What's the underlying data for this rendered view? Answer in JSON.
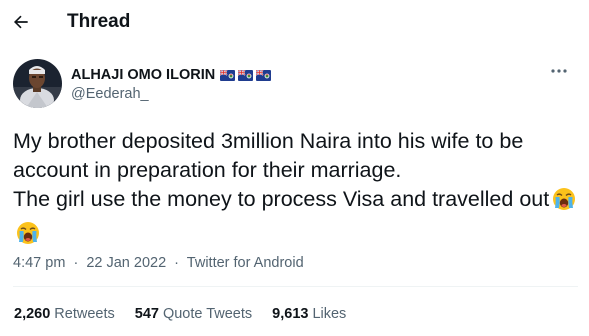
{
  "header": {
    "title": "Thread",
    "back_icon": "arrow-left-icon"
  },
  "author": {
    "display_name": "ALHAJI OMO ILORIN",
    "flags": [
      "cayman-islands-flag",
      "cayman-islands-flag",
      "cayman-islands-flag"
    ],
    "handle": "@Eederah_",
    "avatar": "profile-photo",
    "more_icon": "more-horizontal-icon"
  },
  "tweet": {
    "text": "My brother deposited 3million Naira into his wife to be account in preparation for their marriage.\nThe girl use the money to process Visa and travelled out",
    "emojis": [
      "loudly-crying-face",
      "loudly-crying-face"
    ]
  },
  "meta": {
    "time": "4:47 pm",
    "separator": "·",
    "date": "22 Jan 2022",
    "source": "Twitter for Android"
  },
  "stats": {
    "retweets_count": "2,260",
    "retweets_label": "Retweets",
    "quotes_count": "547",
    "quotes_label": "Quote Tweets",
    "likes_count": "9,613",
    "likes_label": "Likes"
  },
  "colors": {
    "text_primary": "#0f1419",
    "text_secondary": "#536471",
    "divider": "#eff3f4"
  }
}
